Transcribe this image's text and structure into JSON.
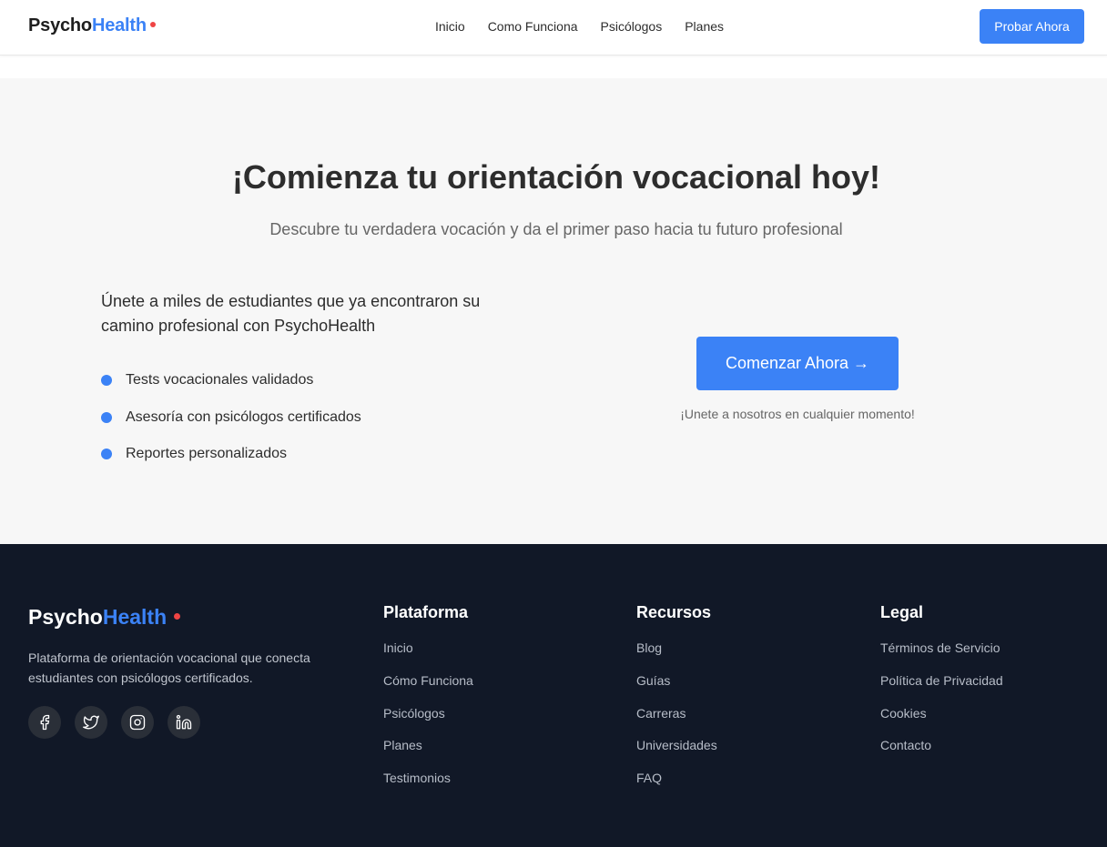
{
  "header": {
    "logo_part1": "Psycho",
    "logo_part2": "Health",
    "nav": [
      "Inicio",
      "Como Funciona",
      "Psicólogos",
      "Planes"
    ],
    "cta_label": "Probar Ahora"
  },
  "cta": {
    "title": "¡Comienza tu orientación vocacional hoy!",
    "subtitle": "Descubre tu verdadera vocación y da el primer paso hacia tu futuro profesional",
    "join_text": "Únete a miles de estudiantes que ya encontraron su camino profesional con PsychoHealth",
    "features": [
      "Tests vocacionales validados",
      "Asesoría con psicólogos certificados",
      "Reportes personalizados"
    ],
    "button_label": "Comenzar Ahora →",
    "note": "¡Unete a nosotros en cualquier momento!"
  },
  "footer": {
    "logo_part1": "Psycho",
    "logo_part2": "Health",
    "description": "Plataforma de orientación vocacional que conecta estudiantes con psicólogos certificados.",
    "socials": [
      "facebook-icon",
      "twitter-icon",
      "instagram-icon",
      "linkedin-icon"
    ],
    "columns": [
      {
        "title": "Plataforma",
        "links": [
          "Inicio",
          "Cómo Funciona",
          "Psicólogos",
          "Planes",
          "Testimonios"
        ]
      },
      {
        "title": "Recursos",
        "links": [
          "Blog",
          "Guías",
          "Carreras",
          "Universidades",
          "FAQ"
        ]
      },
      {
        "title": "Legal",
        "links": [
          "Términos de Servicio",
          "Política de Privacidad",
          "Cookies",
          "Contacto"
        ]
      }
    ]
  },
  "colors": {
    "accent": "#3b82f6",
    "logo_dot": "#ef4444",
    "footer_bg": "#111827",
    "section_bg": "#f7f7f7"
  }
}
